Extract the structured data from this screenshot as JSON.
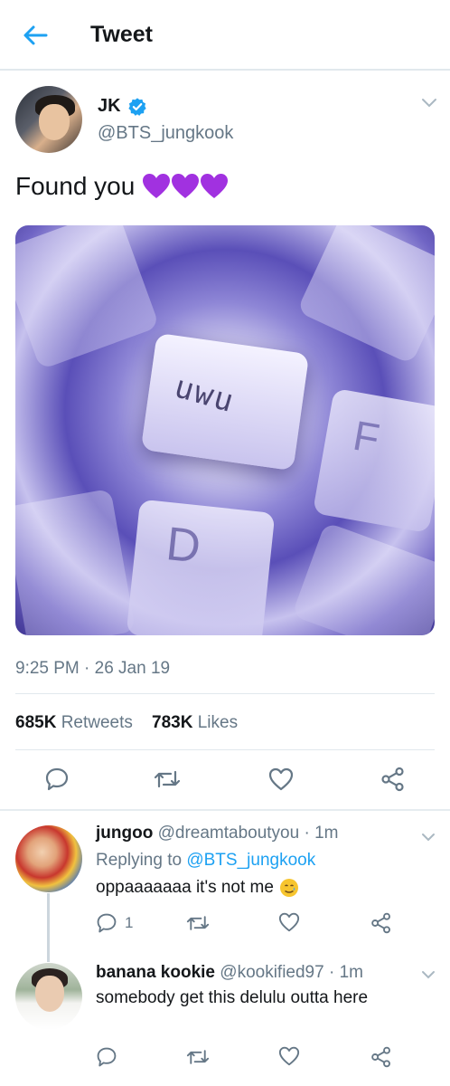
{
  "header": {
    "title": "Tweet"
  },
  "tweet": {
    "author_name": "JK",
    "author_handle": "@BTS_jungkook",
    "text": "Found you",
    "emoji_hearts": "💜💜💜",
    "media_key_main": "uwu",
    "media_key_f": "F",
    "media_key_d": "D",
    "timestamp": "9:25 PM · 26 Jan 19",
    "retweets_count": "685K",
    "retweets_label": "Retweets",
    "likes_count": "783K",
    "likes_label": "Likes"
  },
  "replies": [
    {
      "name": "jungoo",
      "handle": "@dreamtaboutyou",
      "time": " · 1m",
      "replying_prefix": "Replying to",
      "replying_to": "@BTS_jungkook",
      "text": "oppaaaaaaa it's not me",
      "emoji": "🥲",
      "reply_count": "1"
    },
    {
      "name": "banana kookie",
      "handle": "@kookified97",
      "time": " · 1m",
      "text": "somebody get this delulu outta here"
    }
  ],
  "colors": {
    "accent": "#1da1f2",
    "secondary_text": "#657786",
    "heart_purple": "#9b2fd6"
  },
  "icons": {
    "back": "arrow-left-icon",
    "verified": "verified-badge-icon",
    "reply": "reply-icon",
    "retweet": "retweet-icon",
    "like": "heart-icon",
    "share": "share-icon"
  }
}
